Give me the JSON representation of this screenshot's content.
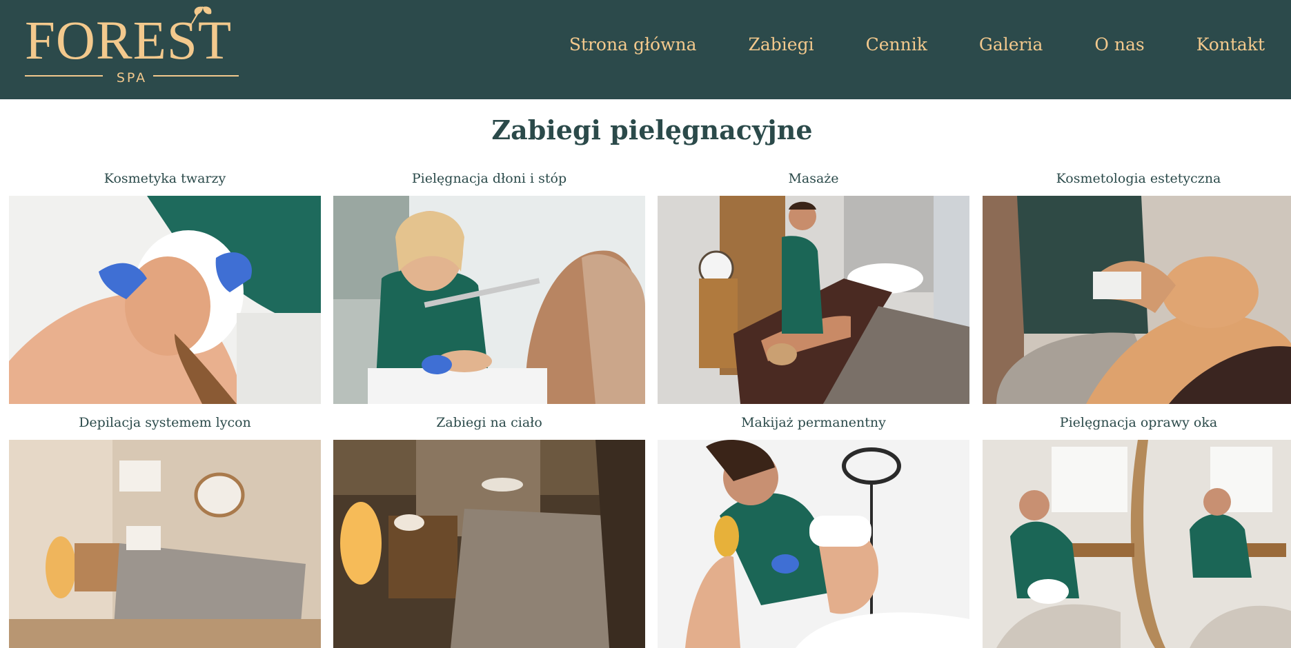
{
  "brand": {
    "name": "FOREST",
    "sub": "SPA"
  },
  "nav": [
    "Strona główna",
    "Zabiegi",
    "Cennik",
    "Galeria",
    "O nas",
    "Kontakt"
  ],
  "page": {
    "title": "Zabiegi pielęgnacyjne"
  },
  "treatments": [
    {
      "label": "Kosmetyka twarzy"
    },
    {
      "label": "Pielęgnacja dłoni i stóp"
    },
    {
      "label": "Masaże"
    },
    {
      "label": "Kosmetologia estetyczna"
    },
    {
      "label": "Depilacja systemem lycon"
    },
    {
      "label": "Zabiegi na ciało"
    },
    {
      "label": "Makijaż permanentny"
    },
    {
      "label": "Pielęgnacja oprawy oka"
    }
  ],
  "colors": {
    "header": "#2c4a4b",
    "gold": "#f3c98d",
    "text": "#2b4a4a",
    "uniform": "#1f6b5c"
  }
}
